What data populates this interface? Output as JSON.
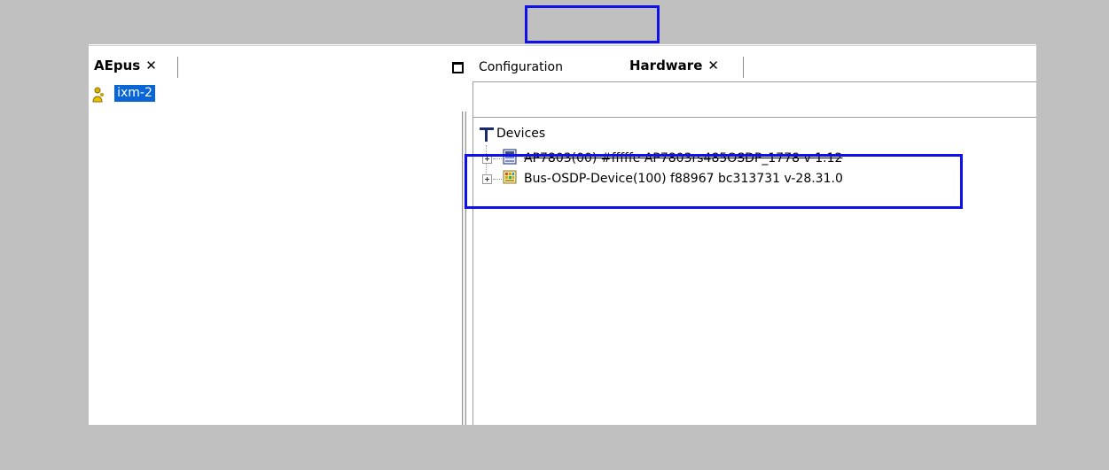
{
  "left_panel": {
    "tab_label": "AEpus",
    "tab_close": "✕",
    "tree_root_label": "ixm-2"
  },
  "right_panel": {
    "tabs": [
      {
        "label": "Configuration"
      },
      {
        "label": "Hardware",
        "close": "✕"
      }
    ],
    "tree": {
      "root_label": "Devices",
      "items": [
        {
          "label": "AP7803(00) #fffffe AP7803rs485OSDP_1778 v 1.12"
        },
        {
          "label": "Bus-OSDP-Device(100) f88967 bc313731 v-28.31.0"
        }
      ]
    }
  },
  "colors": {
    "highlight_box": "#1010e8",
    "selection_bg": "#0a66d6",
    "backdrop": "#c0c0c0"
  }
}
